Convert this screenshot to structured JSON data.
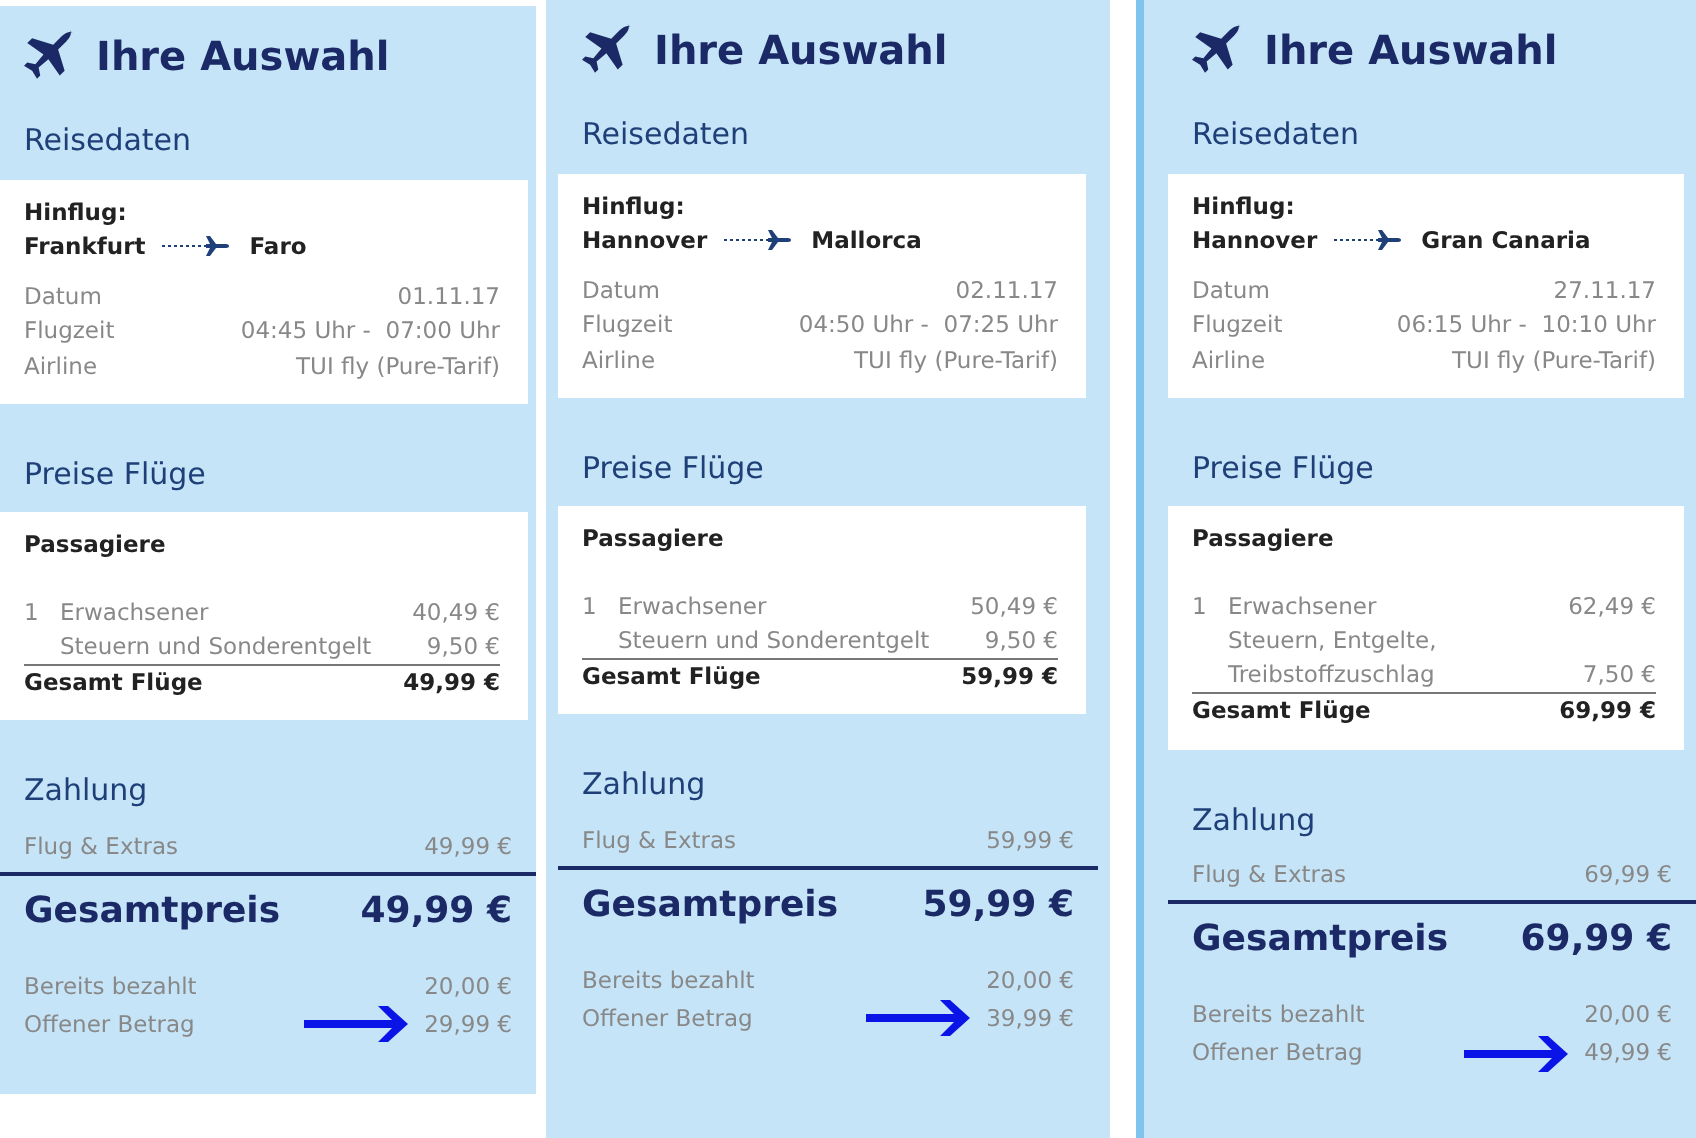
{
  "panels": [
    {
      "title": "Ihre Auswahl",
      "travel": {
        "heading": "Reisedaten",
        "leg_label": "Hinflug:",
        "from": "Frankfurt",
        "to": "Faro",
        "rows": [
          {
            "label": "Datum",
            "value": "01.11.17"
          },
          {
            "label": "Flugzeit",
            "value": "04:45 Uhr -  07:00 Uhr"
          },
          {
            "label": "Airline",
            "value": "TUI fly (Pure-Tarif)"
          }
        ]
      },
      "prices": {
        "heading": "Preise Flüge",
        "subheading": "Passagiere",
        "items": [
          {
            "count": "1",
            "label": "Erwachsener",
            "price": "40,49 €"
          },
          {
            "label": "Steuern und Sonderentgelt",
            "price": "9,50 €"
          }
        ],
        "total_label": "Gesamt Flüge",
        "total": "49,99 €"
      },
      "payment": {
        "heading": "Zahlung",
        "subtotal_label": "Flug & Extras",
        "subtotal": "49,99 €",
        "total_label": "Gesamtpreis",
        "total": "49,99 €",
        "rows": [
          {
            "label": "Bereits bezahlt",
            "value": "20,00 €",
            "highlighted": false
          },
          {
            "label": "Offener Betrag",
            "value": "29,99 €",
            "highlighted": true
          }
        ]
      }
    },
    {
      "title": "Ihre Auswahl",
      "travel": {
        "heading": "Reisedaten",
        "leg_label": "Hinflug:",
        "from": "Hannover",
        "to": "Mallorca",
        "rows": [
          {
            "label": "Datum",
            "value": "02.11.17"
          },
          {
            "label": "Flugzeit",
            "value": "04:50 Uhr -  07:25 Uhr"
          },
          {
            "label": "Airline",
            "value": "TUI fly (Pure-Tarif)"
          }
        ]
      },
      "prices": {
        "heading": "Preise Flüge",
        "subheading": "Passagiere",
        "items": [
          {
            "count": "1",
            "label": "Erwachsener",
            "price": "50,49 €"
          },
          {
            "label": "Steuern und Sonderentgelt",
            "price": "9,50 €"
          }
        ],
        "total_label": "Gesamt Flüge",
        "total": "59,99 €"
      },
      "payment": {
        "heading": "Zahlung",
        "subtotal_label": "Flug & Extras",
        "subtotal": "59,99 €",
        "total_label": "Gesamtpreis",
        "total": "59,99 €",
        "rows": [
          {
            "label": "Bereits bezahlt",
            "value": "20,00 €",
            "highlighted": false
          },
          {
            "label": "Offener Betrag",
            "value": "39,99 €",
            "highlighted": true
          }
        ]
      }
    },
    {
      "title": "Ihre Auswahl",
      "travel": {
        "heading": "Reisedaten",
        "leg_label": "Hinflug:",
        "from": "Hannover",
        "to": "Gran Canaria",
        "rows": [
          {
            "label": "Datum",
            "value": "27.11.17"
          },
          {
            "label": "Flugzeit",
            "value": "06:15 Uhr -  10:10 Uhr"
          },
          {
            "label": "Airline",
            "value": "TUI fly (Pure-Tarif)"
          }
        ]
      },
      "prices": {
        "heading": "Preise Flüge",
        "subheading": "Passagiere",
        "items": [
          {
            "count": "1",
            "label": "Erwachsener",
            "price": "62,49 €"
          },
          {
            "label": "Steuern, Entgelte, Treibstoffzuschlag",
            "price": "7,50 €"
          }
        ],
        "total_label": "Gesamt Flüge",
        "total": "69,99 €"
      },
      "payment": {
        "heading": "Zahlung",
        "subtotal_label": "Flug & Extras",
        "subtotal": "69,99 €",
        "total_label": "Gesamtpreis",
        "total": "69,99 €",
        "rows": [
          {
            "label": "Bereits bezahlt",
            "value": "20,00 €",
            "highlighted": false
          },
          {
            "label": "Offener Betrag",
            "value": "49,99 €",
            "highlighted": true
          }
        ]
      }
    }
  ]
}
